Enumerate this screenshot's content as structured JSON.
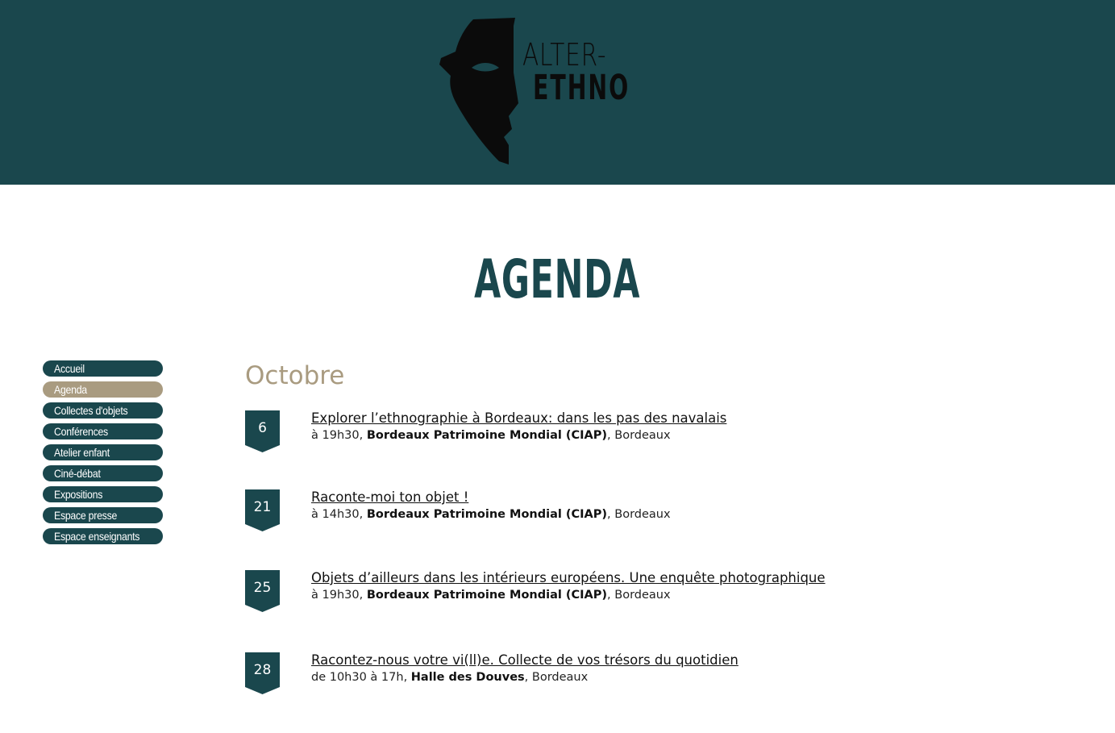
{
  "logo": {
    "line1": "ALTER-",
    "line2": "ETHNO",
    "icon": "mask-icon"
  },
  "page_title": "AGENDA",
  "sidebar": {
    "items": [
      {
        "label": "Accueil",
        "active": false
      },
      {
        "label": "Agenda",
        "active": true
      },
      {
        "label": "Collectes d'objets",
        "active": false
      },
      {
        "label": "Conférences",
        "active": false
      },
      {
        "label": "Atelier enfant",
        "active": false
      },
      {
        "label": "Ciné-débat",
        "active": false
      },
      {
        "label": "Expositions",
        "active": false
      },
      {
        "label": "Espace presse",
        "active": false
      },
      {
        "label": "Espace enseignants",
        "active": false
      }
    ]
  },
  "month": "Octobre",
  "events": [
    {
      "day": "6",
      "title": "Explorer l’ethnographie à Bordeaux: dans les pas des navalais",
      "time": " à 19h30",
      "venue": "Bordeaux Patrimoine Mondial (CIAP)",
      "city": ", Bordeaux"
    },
    {
      "day": "21",
      "title": "Raconte-moi ton objet !",
      "time": "à 14h30",
      "venue": "Bordeaux Patrimoine Mondial (CIAP)",
      "city": ", Bordeaux"
    },
    {
      "day": "25",
      "title": "Objets d’ailleurs dans les intérieurs européens. Une enquête photographique",
      "time": "à 19h30",
      "venue": "Bordeaux Patrimoine Mondial (CIAP)",
      "city": ", Bordeaux"
    },
    {
      "day": "28",
      "title": "Racontez-nous votre vi(ll)e. Collecte de vos trésors du quotidien",
      "time": "de 10h30 à 17h",
      "venue": "Halle des Douves",
      "city": ", Bordeaux"
    }
  ],
  "colors": {
    "brand": "#1a474d",
    "accent": "#a99b80"
  }
}
